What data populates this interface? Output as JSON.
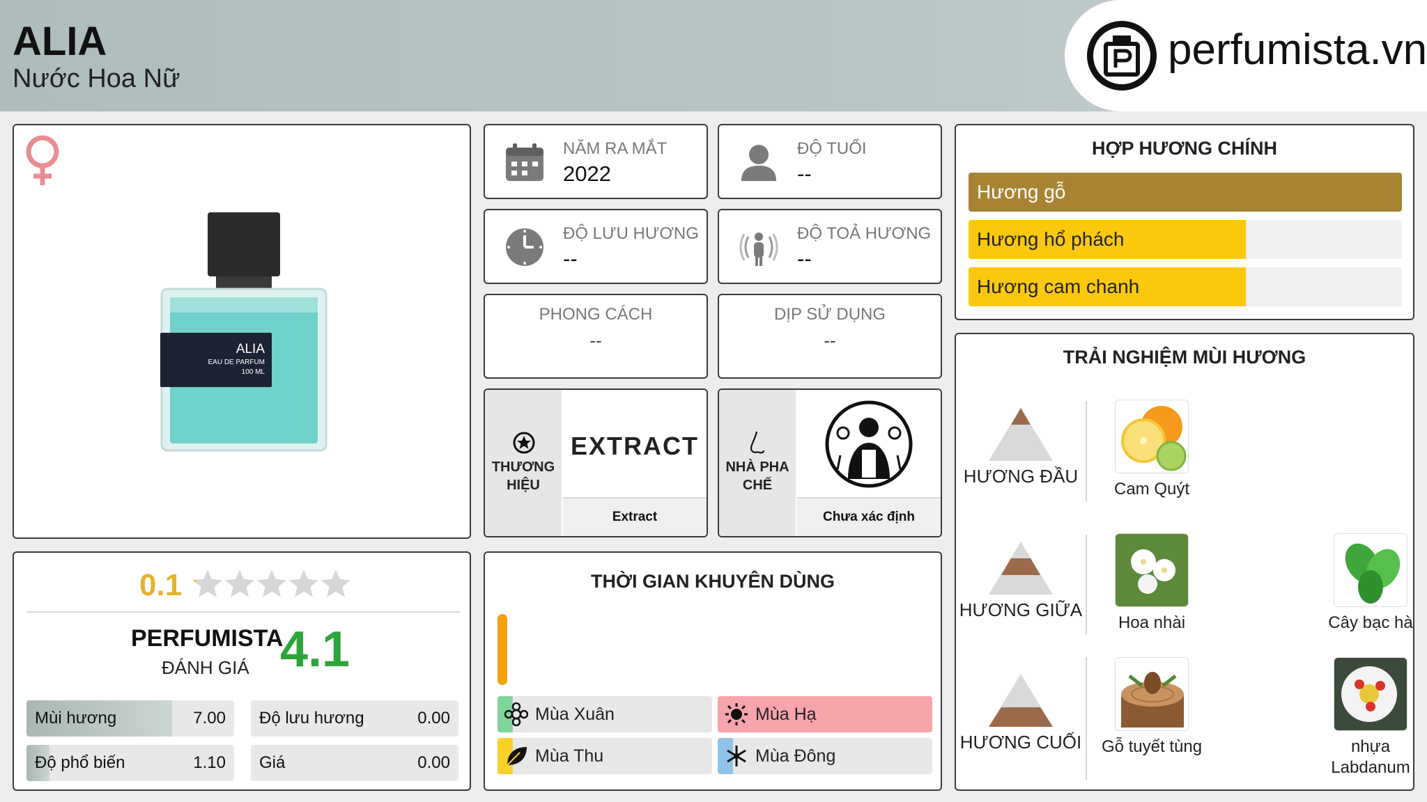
{
  "header": {
    "title": "ALIA",
    "subtitle": "Nước Hoa Nữ",
    "logo_text": "perfumista.vn"
  },
  "product": {
    "bottle_label_name": "ALIA",
    "bottle_label_line1": "EAU DE PARFUM",
    "bottle_label_line2": "100 ML"
  },
  "info": {
    "release_year": {
      "label": "NĂM RA MẮT",
      "value": "2022"
    },
    "age": {
      "label": "ĐỘ TUỔI",
      "value": "--"
    },
    "longevity": {
      "label": "ĐỘ LƯU HƯƠNG",
      "value": "--"
    },
    "sillage": {
      "label": "ĐỘ TOẢ HƯƠNG",
      "value": "--"
    },
    "style": {
      "label": "PHONG CÁCH",
      "value": "--"
    },
    "occasion": {
      "label": "DỊP SỬ DỤNG",
      "value": "--"
    },
    "brand": {
      "label": "THƯƠNG HIỆU",
      "logo_text": "EXTRACT",
      "name": "Extract"
    },
    "perfumer": {
      "label": "NHÀ PHA CHẾ",
      "name": "Chưa xác định"
    }
  },
  "accords": {
    "title": "HỢP HƯƠNG CHÍNH",
    "items": [
      {
        "label": "Hương gỗ",
        "fill": 1.0,
        "color": "#a88432",
        "text_color": "#ffffff"
      },
      {
        "label": "Hương hổ phách",
        "fill": 0.64,
        "color": "#fbc80c",
        "text_color": "#222222"
      },
      {
        "label": "Hương cam chanh",
        "fill": 0.64,
        "color": "#fbc80c",
        "text_color": "#222222"
      }
    ]
  },
  "rating": {
    "user_score": "0.1",
    "stars_filled": 0.1,
    "perfumista_title": "PERFUMISTA",
    "perfumista_sub": "ĐÁNH GIÁ",
    "perfumista_score": "4.1",
    "metrics": [
      {
        "label": "Mùi hương",
        "value": "7.00",
        "fill": 0.7
      },
      {
        "label": "Độ lưu hương",
        "value": "0.00",
        "fill": 0.0
      },
      {
        "label": "Độ phổ biến",
        "value": "1.10",
        "fill": 0.11
      },
      {
        "label": "Giá",
        "value": "0.00",
        "fill": 0.0
      }
    ]
  },
  "seasons": {
    "title": "THỜI GIAN KHUYÊN DÙNG",
    "items": [
      {
        "label": "Mùa Xuân",
        "stripe": "#7fd49a",
        "highlight": false
      },
      {
        "label": "Mùa Hạ",
        "stripe": "#f7a4ad",
        "highlight": true
      },
      {
        "label": "Mùa Thu",
        "stripe": "#fbd02a",
        "highlight": false
      },
      {
        "label": "Mùa Đông",
        "stripe": "#8fc3ea",
        "highlight": false
      }
    ]
  },
  "notes": {
    "title": "TRẢI NGHIỆM MÙI HƯƠNG",
    "top": {
      "label": "HƯƠNG ĐẦU",
      "items": [
        "Cam Quýt"
      ]
    },
    "middle": {
      "label": "HƯƠNG GIỮA",
      "items": [
        "Hoa nhài",
        "Cây bạc hà"
      ]
    },
    "base": {
      "label": "HƯƠNG CUỐI",
      "items": [
        "Gỗ tuyết tùng",
        "nhựa Labdanum"
      ]
    }
  }
}
